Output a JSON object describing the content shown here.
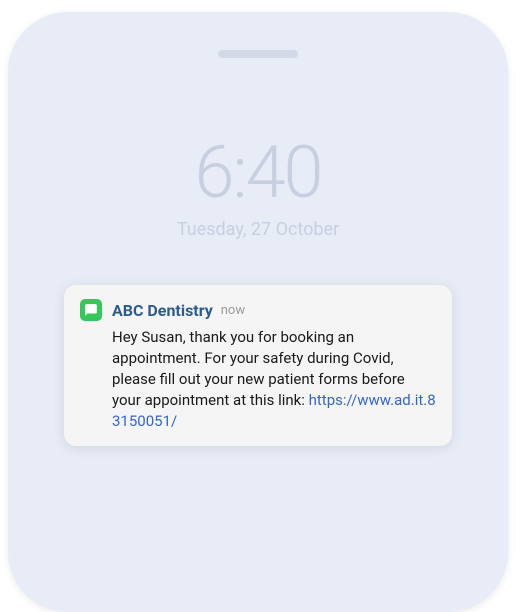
{
  "lockscreen": {
    "time": "6:40",
    "date": "Tuesday, 27 October"
  },
  "notification": {
    "app_name": "ABC Dentistry",
    "timestamp": "now",
    "message": "Hey Susan, thank you for booking an appointment. For your safety during Covid, please fill out your new patient forms before your appointment at this link: ",
    "link": "https://www.ad.it.83150051/"
  },
  "colors": {
    "phone_body": "#e8ecf6",
    "lock_text": "#c8cfe0",
    "title": "#2b5c8e",
    "link": "#3366cc",
    "app_icon": "#34c759"
  }
}
